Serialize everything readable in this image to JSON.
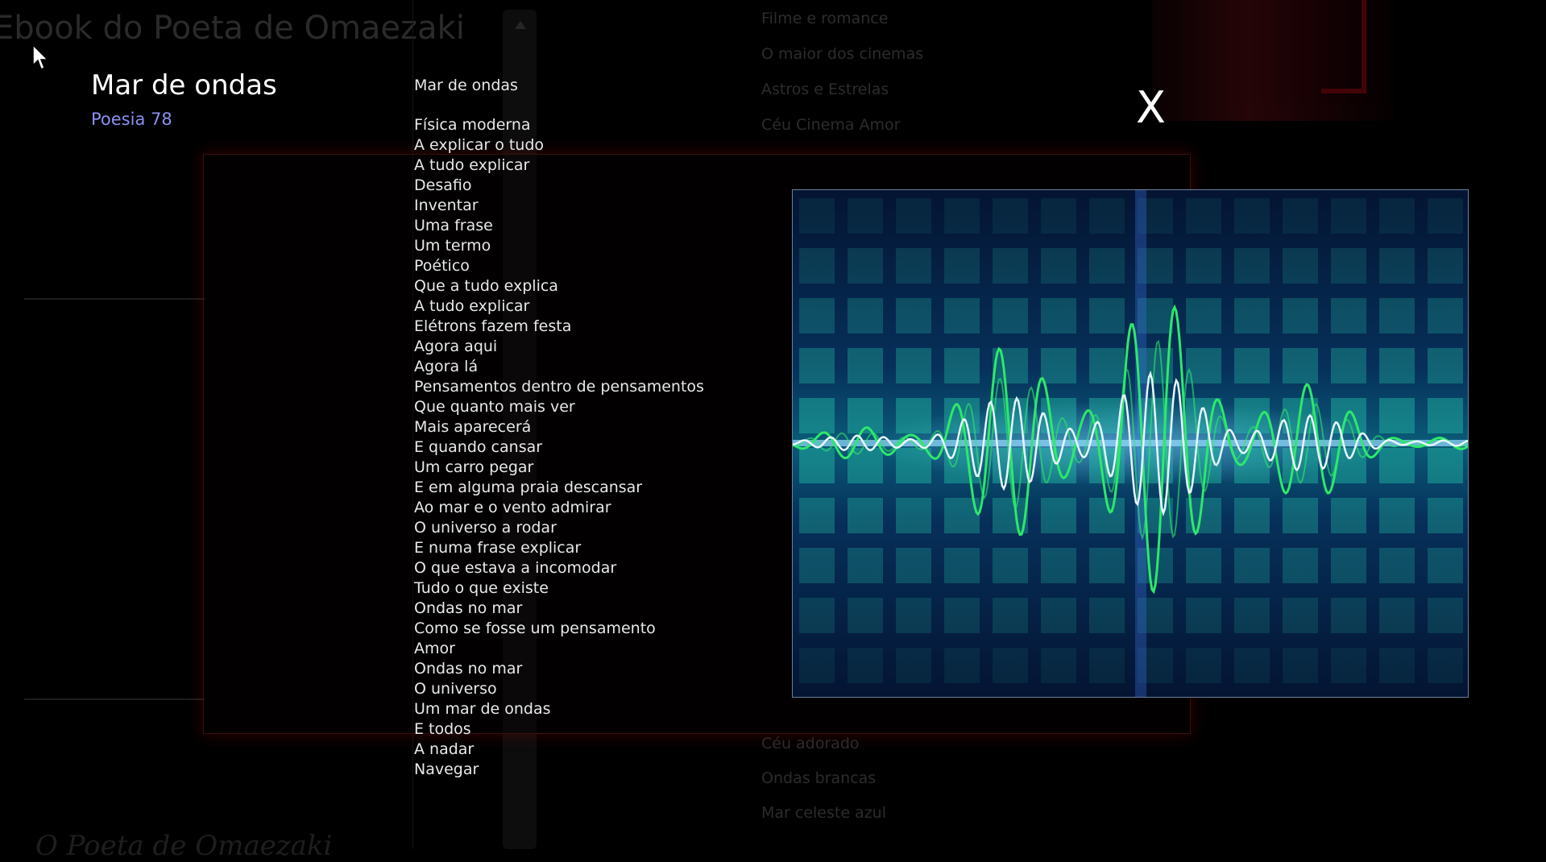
{
  "background": {
    "site_title": "Ebook do Poeta de Omaezaki",
    "menu_top": [
      "Filme e romance",
      "O maior dos cinemas",
      "Astros e Estrelas",
      "Céu Cinema Amor"
    ],
    "menu_bottom": [
      "Céu adorado",
      "Ondas brancas",
      "Mar celeste azul"
    ],
    "footer_text": "O Poeta de Omaezaki"
  },
  "overlay": {
    "title": "Mar de ondas",
    "subtitle": "Poesia 78",
    "close_label": "X"
  },
  "poem": {
    "heading": "Mar de ondas",
    "lines": [
      "Física moderna",
      "A explicar o tudo",
      "A tudo explicar",
      "Desafio",
      "Inventar",
      "Uma frase",
      "Um termo",
      "Poético",
      "Que a tudo explica",
      "A tudo explicar",
      "Elétrons fazem festa",
      "Agora aqui",
      "Agora lá",
      "Pensamentos dentro de pensamentos",
      "Que quanto mais ver",
      "Mais aparecerá",
      "E quando cansar",
      "Um carro pegar",
      "E em alguma praia descansar",
      "Ao mar e o vento admirar",
      "O universo a rodar",
      "E numa frase explicar",
      "O que estava a incomodar",
      "Tudo o que existe",
      "Ondas no mar",
      "Como se fosse um pensamento",
      "Amor",
      "Ondas no mar",
      "O universo",
      "Um mar de ondas",
      "E todos",
      "A nadar",
      "Navegar"
    ]
  },
  "image": {
    "description_icon": "sound-wave-image"
  },
  "colors": {
    "subtitle": "#8b8ff0",
    "frame_border": "#3a0f0f",
    "wave_green": "#2ee86a",
    "wave_white": "#e8f6ff"
  }
}
